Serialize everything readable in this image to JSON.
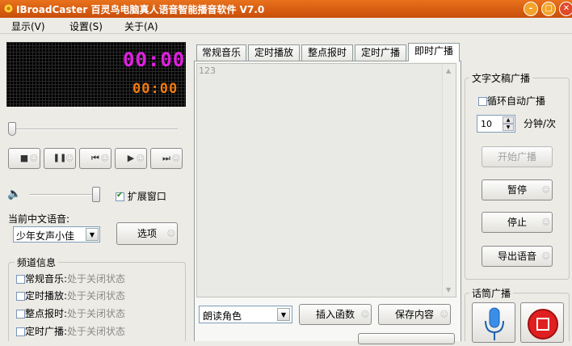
{
  "window": {
    "title": "IBroadCaster 百灵鸟电脑真人语音智能播音软件 V7.0",
    "min_glyph": "–",
    "max_glyph": "□",
    "close_glyph": "✕"
  },
  "menu": [
    "显示(V)",
    "设置(S)",
    "关于(A)"
  ],
  "led": {
    "time_main": "00:00",
    "time_sub": "00:00",
    "main_color": "#e020e0",
    "sub_color": "#f07a10"
  },
  "playback": {
    "stop": "■",
    "pause": "❚❚",
    "prev": "⏮",
    "play": "▶",
    "next": "⏭"
  },
  "volume_icon": "🔈",
  "expand_window_label": "扩展窗口",
  "voice": {
    "label": "当前中文语音:",
    "selected": "少年女声小佳",
    "options_button": "选项"
  },
  "channel_info": {
    "title": "频道信息",
    "items": [
      {
        "name": "常规音乐:",
        "status": "处于关闭状态"
      },
      {
        "name": "定时播放:",
        "status": "处于关闭状态"
      },
      {
        "name": "整点报时:",
        "status": "处于关闭状态"
      },
      {
        "name": "定时广播:",
        "status": "处于关闭状态"
      }
    ]
  },
  "tabs": [
    "常规音乐",
    "定时播放",
    "整点报时",
    "定时广播",
    "即时广播"
  ],
  "active_tab": 4,
  "editor": {
    "text": "123"
  },
  "bottom": {
    "role_selected": "朗读角色",
    "insert_function": "插入函数",
    "save_content": "保存内容"
  },
  "text_broadcast": {
    "title": "文字文稿广播",
    "loop_label": "循环自动广播",
    "interval_value": "10",
    "interval_unit": "分钟/次",
    "start": "开始广播",
    "pause": "暂停",
    "stop": "停止",
    "export": "导出语音"
  },
  "mic_broadcast": {
    "title": "话筒广播"
  }
}
